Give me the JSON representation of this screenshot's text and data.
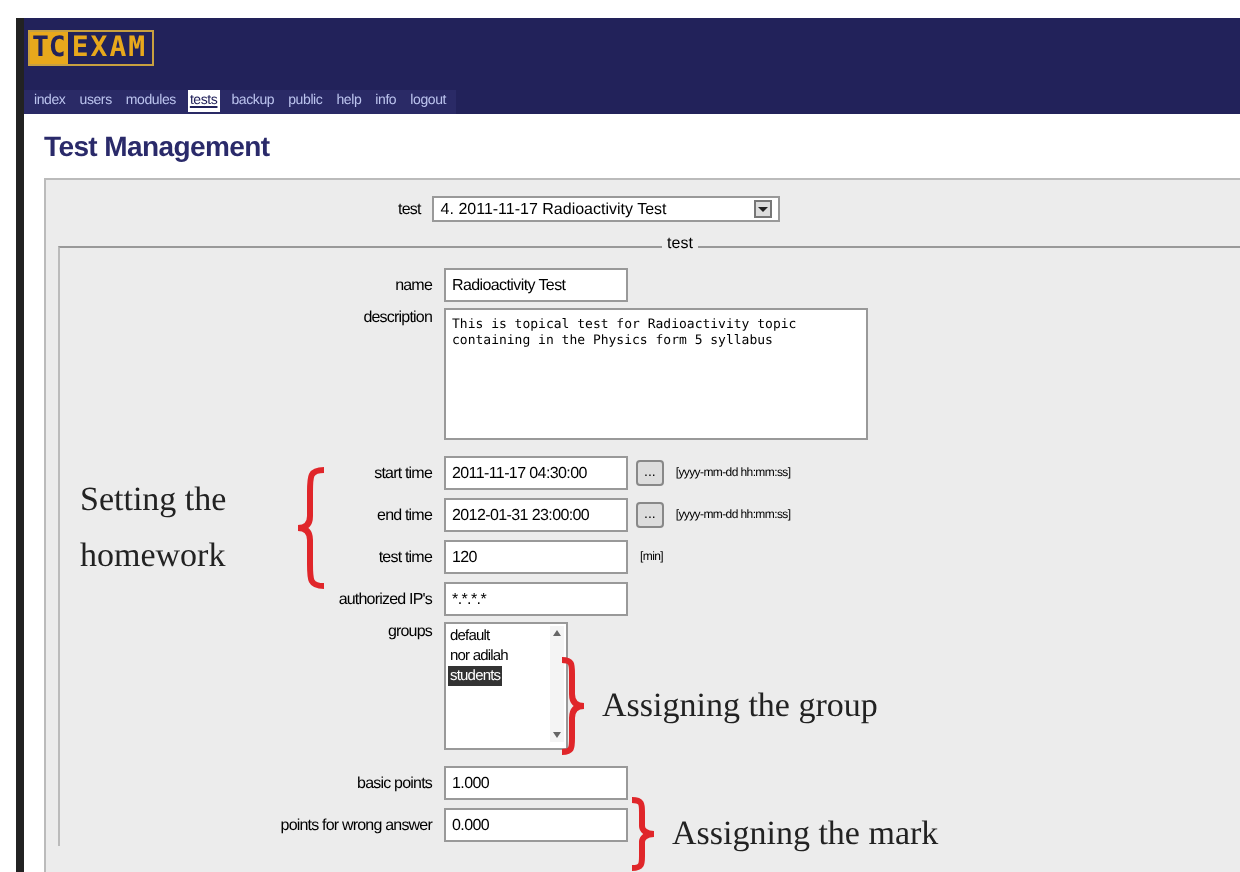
{
  "logo": {
    "part_1": "TC",
    "part_2": "EXAM"
  },
  "nav": [
    {
      "label": "index",
      "selected": false
    },
    {
      "label": "users",
      "selected": false
    },
    {
      "label": "modules",
      "selected": false
    },
    {
      "label": "tests",
      "selected": true
    },
    {
      "label": "backup",
      "selected": false
    },
    {
      "label": "public",
      "selected": false
    },
    {
      "label": "help",
      "selected": false
    },
    {
      "label": "info",
      "selected": false
    },
    {
      "label": "logout",
      "selected": false
    }
  ],
  "title": "Test Management",
  "test_select": {
    "label": "test",
    "value": "4. 2011-11-17 Radioactivity Test"
  },
  "fieldset": {
    "legend": "test",
    "rows": [
      {
        "kind": "text",
        "label": "name",
        "value": "Radioactivity Test"
      },
      {
        "kind": "textarea",
        "label": "description",
        "value": "This is topical test for Radioactivity topic\ncontaining in the Physics form 5 syllabus"
      },
      {
        "kind": "date",
        "label": "start time",
        "value": "2011-11-17 04:30:00",
        "button": "...",
        "hint": "[yyyy-mm-dd hh:mm:ss]"
      },
      {
        "kind": "date",
        "label": "end time",
        "value": "2012-01-31 23:00:00",
        "button": "...",
        "hint": "[yyyy-mm-dd hh:mm:ss]"
      },
      {
        "kind": "text",
        "label": "test time",
        "value": "120",
        "hint": "[min]"
      },
      {
        "kind": "text",
        "label": "authorized IP's",
        "value": "*.*.*.*"
      },
      {
        "kind": "list",
        "label": "groups",
        "options": [
          {
            "label": "default",
            "selected": false
          },
          {
            "label": "nor adilah",
            "selected": false
          },
          {
            "label": "students",
            "selected": true
          }
        ]
      },
      {
        "kind": "text",
        "label": "basic points",
        "value": "1.000"
      },
      {
        "kind": "text",
        "label": "points for wrong answer",
        "value": "0.000"
      }
    ]
  },
  "annotations": [
    {
      "kind": "open",
      "text": "Setting the homework"
    },
    {
      "kind": "close",
      "text": "Assigning the group"
    },
    {
      "kind": "close",
      "text": "Assigning the mark"
    }
  ]
}
